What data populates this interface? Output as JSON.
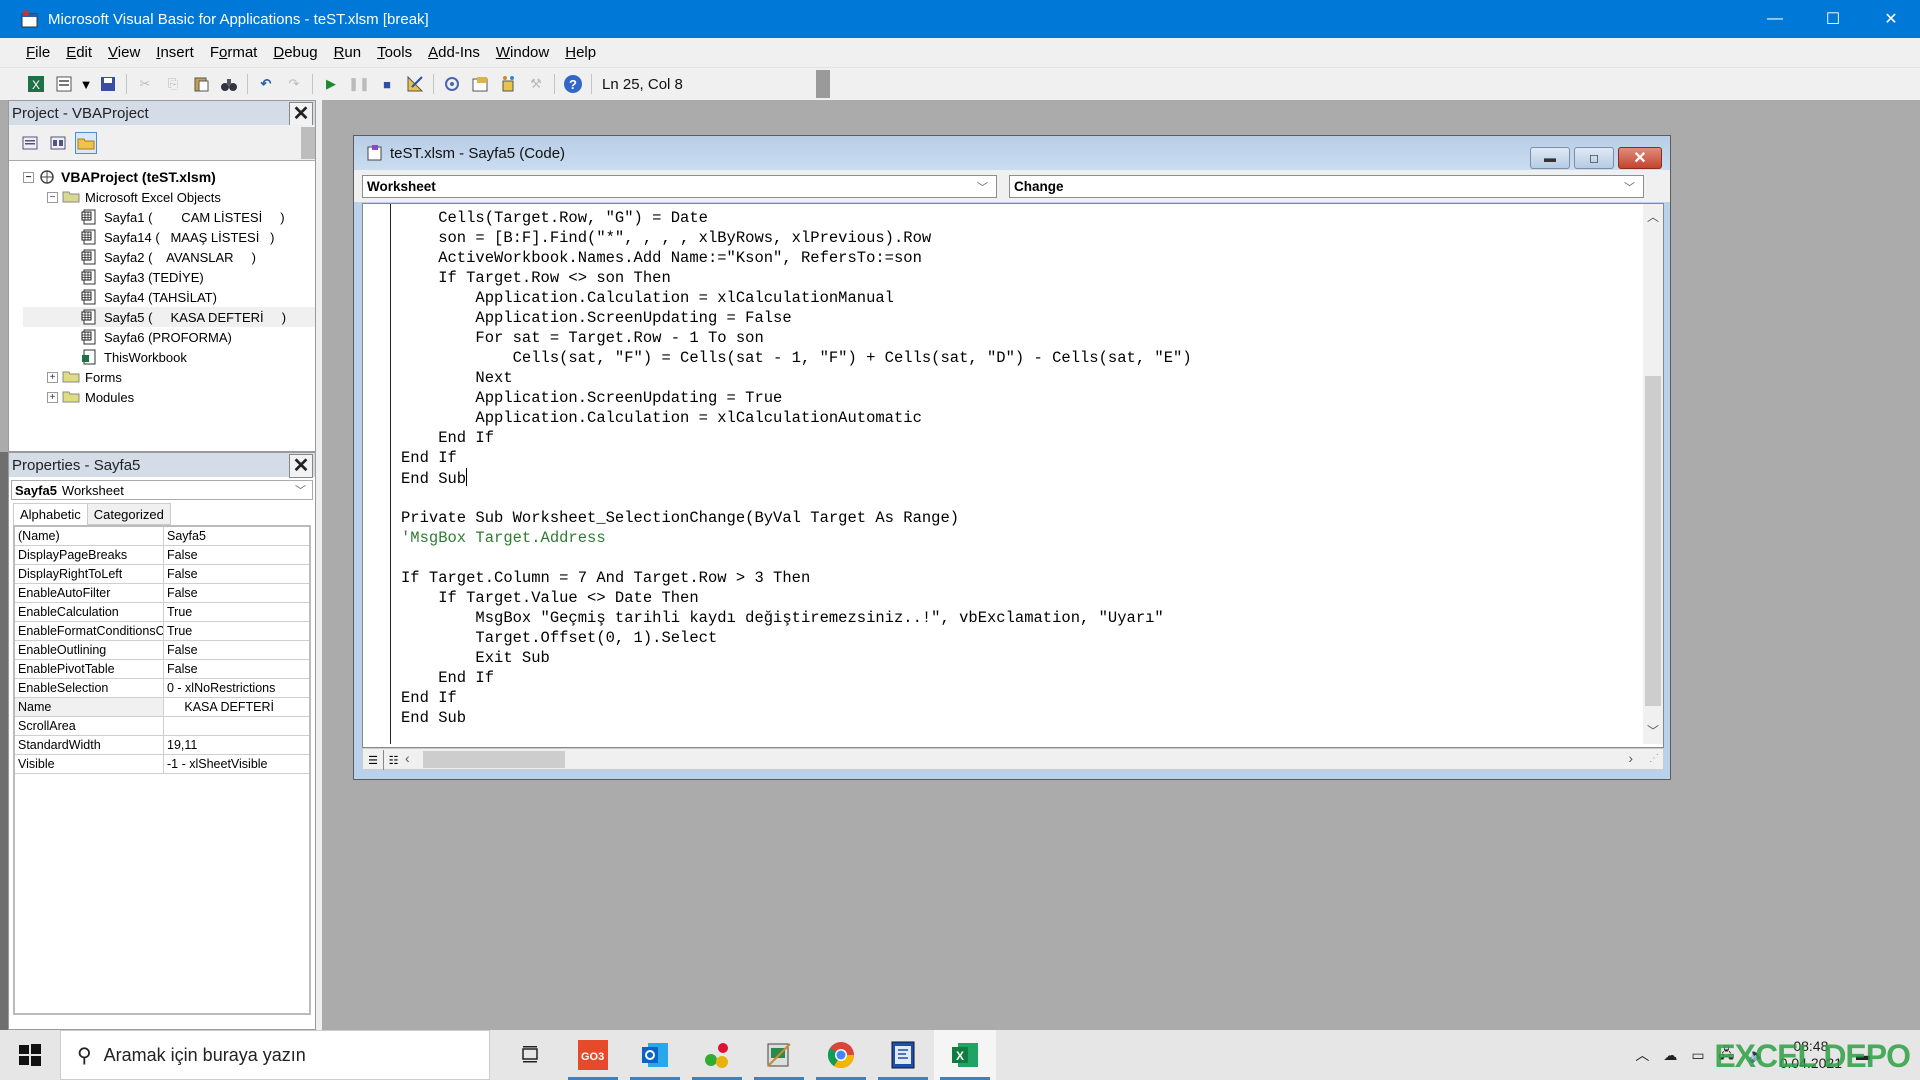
{
  "window": {
    "title": "Microsoft Visual Basic for Applications - teST.xlsm [break]",
    "controls": {
      "minimize": "—",
      "maximize": "☐",
      "close": "✕"
    }
  },
  "menu": [
    {
      "label": "File",
      "accel": "F",
      "rest": "ile"
    },
    {
      "label": "Edit",
      "accel": "E",
      "rest": "dit"
    },
    {
      "label": "View",
      "accel": "V",
      "rest": "iew"
    },
    {
      "label": "Insert",
      "accel": "I",
      "rest": "nsert"
    },
    {
      "label": "Format",
      "accel": "o",
      "pre": "F",
      "rest": "rmat"
    },
    {
      "label": "Debug",
      "accel": "D",
      "rest": "ebug"
    },
    {
      "label": "Run",
      "accel": "R",
      "rest": "un"
    },
    {
      "label": "Tools",
      "accel": "T",
      "rest": "ools"
    },
    {
      "label": "Add-Ins",
      "accel": "A",
      "rest": "dd-Ins"
    },
    {
      "label": "Window",
      "accel": "W",
      "rest": "indow"
    },
    {
      "label": "Help",
      "accel": "H",
      "rest": "elp"
    }
  ],
  "toolbar": {
    "icons": [
      "view-excel-icon",
      "insert-userform-icon",
      "dropdown-arrow-icon",
      "save-icon",
      "cut-icon",
      "copy-icon",
      "paste-icon",
      "find-icon",
      "undo-icon",
      "redo-icon",
      "run-icon",
      "break-icon",
      "reset-icon",
      "design-mode-icon",
      "project-explorer-icon",
      "properties-window-icon",
      "object-browser-icon",
      "toolbox-icon",
      "help-icon"
    ],
    "status": "Ln 25, Col 8"
  },
  "project_panel": {
    "title": "Project - VBAProject",
    "close": "✕",
    "tree": {
      "root": "VBAProject (teST.xlsm)",
      "folder_excel_objects": "Microsoft Excel Objects",
      "items": [
        "Sayfa1 (        CAM LİSTESİ     )",
        "Sayfa14 (   MAAŞ LİSTESİ   )",
        "Sayfa2 (    AVANSLAR     )",
        "Sayfa3 (TEDİYE)",
        "Sayfa4 (TAHSİLAT)",
        "Sayfa5 (     KASA DEFTERİ     )",
        "Sayfa6 (PROFORMA)",
        "ThisWorkbook"
      ],
      "selected_index": 5,
      "folder_forms": "Forms",
      "folder_modules": "Modules"
    }
  },
  "properties_panel": {
    "title": "Properties - Sayfa5",
    "close": "✕",
    "object_name": "Sayfa5",
    "object_type": "Worksheet",
    "tabs": [
      "Alphabetic",
      "Categorized"
    ],
    "active_tab": "Alphabetic",
    "rows": [
      {
        "key": "(Name)",
        "value": "Sayfa5"
      },
      {
        "key": "DisplayPageBreaks",
        "value": "False"
      },
      {
        "key": "DisplayRightToLeft",
        "value": "False"
      },
      {
        "key": "EnableAutoFilter",
        "value": "False"
      },
      {
        "key": "EnableCalculation",
        "value": "True"
      },
      {
        "key": "EnableFormatConditionsCalculation",
        "value": "True"
      },
      {
        "key": "EnableOutlining",
        "value": "False"
      },
      {
        "key": "EnablePivotTable",
        "value": "False"
      },
      {
        "key": "EnableSelection",
        "value": "0 - xlNoRestrictions"
      },
      {
        "key": "Name",
        "value": "     KASA DEFTERİ"
      },
      {
        "key": "ScrollArea",
        "value": ""
      },
      {
        "key": "StandardWidth",
        "value": "19,11"
      },
      {
        "key": "Visible",
        "value": "-1 - xlSheetVisible"
      }
    ]
  },
  "code_window": {
    "title": "teST.xlsm - Sayfa5 (Code)",
    "object_combo": "Worksheet",
    "procedure_combo": "Change",
    "lines": [
      {
        "text": "    Cells(Target.Row, \"G\") = Date"
      },
      {
        "text": "    son = [B:F].Find(\"*\", , , , xlByRows, xlPrevious).Row"
      },
      {
        "text": "    ActiveWorkbook.Names.Add Name:=\"Kson\", RefersTo:=son"
      },
      {
        "text": "    If Target.Row <> son Then"
      },
      {
        "text": "        Application.Calculation = xlCalculationManual"
      },
      {
        "text": "        Application.ScreenUpdating = False"
      },
      {
        "text": "        For sat = Target.Row - 1 To son"
      },
      {
        "text": "            Cells(sat, \"F\") = Cells(sat - 1, \"F\") + Cells(sat, \"D\") - Cells(sat, \"E\")"
      },
      {
        "text": "        Next"
      },
      {
        "text": "        Application.ScreenUpdating = True"
      },
      {
        "text": "        Application.Calculation = xlCalculationAutomatic"
      },
      {
        "text": "    End If"
      },
      {
        "text": "End If"
      },
      {
        "text": "End Sub",
        "caret": true
      },
      {
        "text": ""
      },
      {
        "text": "Private Sub Worksheet_SelectionChange(ByVal Target As Range)"
      },
      {
        "text": "'MsgBox Target.Address",
        "comment": true
      },
      {
        "text": ""
      },
      {
        "text": "If Target.Column = 7 And Target.Row > 3 Then"
      },
      {
        "text": "    If Target.Value <> Date Then"
      },
      {
        "text": "        MsgBox \"Geçmiş tarihli kaydı değiştiremezsiniz..!\", vbExclamation, \"Uyarı\""
      },
      {
        "text": "        Target.Offset(0, 1).Select"
      },
      {
        "text": "        Exit Sub"
      },
      {
        "text": "    End If"
      },
      {
        "text": "End If"
      },
      {
        "text": "End Sub"
      }
    ],
    "vscroll_position": 0.35,
    "hscroll_position": 0.0
  },
  "taskbar": {
    "search_placeholder": "Aramak için buraya yazın",
    "apps": [
      "task-view-icon",
      "go3-app-icon",
      "outlook-icon",
      "app-balls-icon",
      "tool-app-icon",
      "chrome-icon",
      "vba-editor-icon",
      "excel-icon"
    ],
    "active_app": "excel-icon",
    "clock_time": "08:48",
    "clock_date": "0.04.2021",
    "watermark": "EXCEL DEPO"
  },
  "colors": {
    "titlebar": "#0078d7",
    "comment": "#2f7d32",
    "code_window_frame": "#b9d1ea"
  }
}
